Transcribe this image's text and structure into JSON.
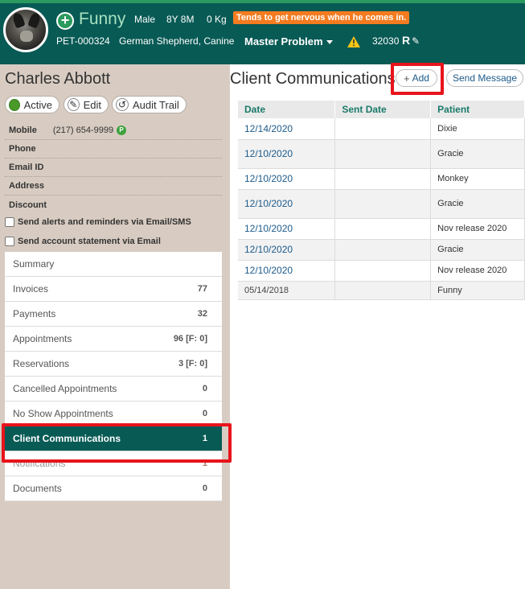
{
  "pet": {
    "name": "Funny",
    "sex": "Male",
    "age": "8Y 8M",
    "weight": "0 Kg",
    "alert": "Tends to get nervous when he comes in.",
    "id": "PET-000324",
    "breed": "German Shepherd, Canine",
    "master_problem": "Master Problem",
    "code": "32030",
    "rx": "R"
  },
  "client": {
    "name": "Charles Abbott",
    "status_label": "Active",
    "edit_label": "Edit",
    "audit_label": "Audit Trail",
    "info": [
      {
        "label": "Mobile",
        "value": "(217) 654-9999",
        "badge": "P"
      },
      {
        "label": "Phone",
        "value": ""
      },
      {
        "label": "Email ID",
        "value": ""
      },
      {
        "label": "Address",
        "value": ""
      },
      {
        "label": "Discount",
        "value": ""
      }
    ],
    "checkboxes": [
      {
        "label": "Send alerts and reminders via Email/SMS",
        "checked": false
      },
      {
        "label": "Send account statement via Email",
        "checked": false
      }
    ]
  },
  "menu": [
    {
      "label": "Summary",
      "count": ""
    },
    {
      "label": "Invoices",
      "count": "77"
    },
    {
      "label": "Payments",
      "count": "32"
    },
    {
      "label": "Appointments",
      "count": "96  [F: 0]"
    },
    {
      "label": "Reservations",
      "count": "3  [F: 0]"
    },
    {
      "label": "Cancelled Appointments",
      "count": "0"
    },
    {
      "label": "No Show Appointments",
      "count": "0"
    },
    {
      "label": "Client Communications",
      "count": "1"
    },
    {
      "label": "Notifications",
      "count": "1"
    },
    {
      "label": "Documents",
      "count": "0"
    }
  ],
  "communications": {
    "title": "Client Communications",
    "add_label": "Add",
    "send_label": "Send Message",
    "columns": [
      "Date",
      "Sent Date",
      "Patient"
    ],
    "rows": [
      {
        "date": "12/14/2020",
        "sent": "",
        "patient": "Dixie"
      },
      {
        "date": "12/10/2020",
        "sent": "",
        "patient": "Gracie"
      },
      {
        "date": "12/10/2020",
        "sent": "",
        "patient": "Monkey"
      },
      {
        "date": "12/10/2020",
        "sent": "",
        "patient": "Gracie"
      },
      {
        "date": "12/10/2020",
        "sent": "",
        "patient": "Nov release 2020"
      },
      {
        "date": "12/10/2020",
        "sent": "",
        "patient": "Gracie"
      },
      {
        "date": "12/10/2020",
        "sent": "",
        "patient": "Nov release 2020"
      },
      {
        "date": "05/14/2018",
        "sent": "",
        "patient": "Funny"
      }
    ]
  },
  "colors": {
    "header_bg": "#085a55",
    "accent_green": "#2b9a5e",
    "alert_orange": "#f47b20",
    "highlight_red": "#e8141c"
  }
}
